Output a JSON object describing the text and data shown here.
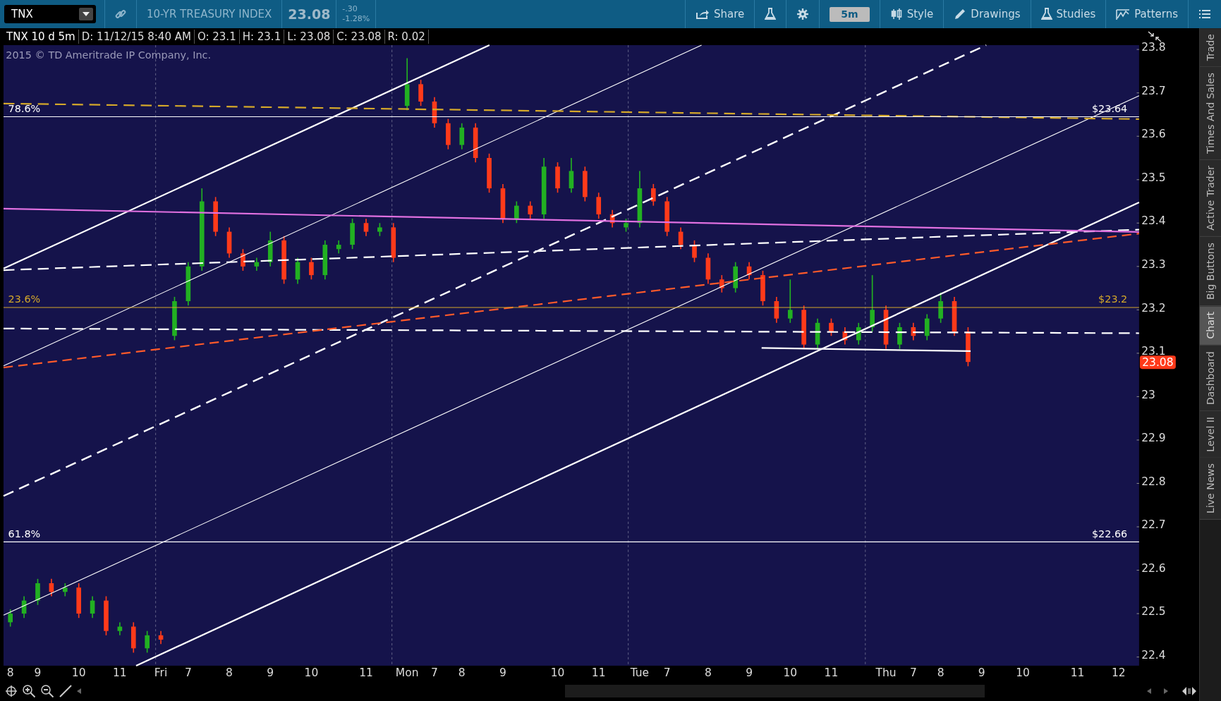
{
  "toolbar": {
    "symbol": "TNX",
    "description": "10-YR TREASURY INDEX",
    "last": "23.08",
    "change": "-.30",
    "change_pct": "-1.28%",
    "buttons": [
      {
        "kind": "share",
        "label": "Share"
      },
      {
        "kind": "flask"
      },
      {
        "kind": "gear"
      },
      {
        "kind": "aggregation",
        "label": "5m"
      },
      {
        "kind": "style",
        "label": "Style"
      },
      {
        "kind": "drawings",
        "label": "Drawings"
      },
      {
        "kind": "studies",
        "label": "Studies"
      },
      {
        "kind": "patterns",
        "label": "Patterns"
      },
      {
        "kind": "list"
      }
    ]
  },
  "info_bar": [
    "TNX 10 d 5m",
    "D: 11/12/15 8:40 AM",
    "O: 23.1",
    "H: 23.1",
    "L: 23.08",
    "C: 23.08",
    "R: 0.02"
  ],
  "chart": {
    "copyright": "2015 © TD Ameritrade IP Company, Inc.",
    "price_badge": "23.08",
    "fib_levels": [
      {
        "label": "78.6%",
        "price_label": "$23.64",
        "color": "#ffffff"
      },
      {
        "label": "23.6%",
        "price_label": "$23.2",
        "color": "#d4a82a"
      },
      {
        "label": "61.8%",
        "price_label": "$22.66",
        "color": "#ffffff"
      }
    ],
    "chart_data": {
      "type": "candlestick",
      "ylim": [
        22.38,
        23.81
      ],
      "categories": [
        "8",
        null,
        "9",
        null,
        null,
        "10",
        null,
        null,
        "11",
        null,
        null,
        "Fri",
        null,
        "7",
        null,
        null,
        "8",
        null,
        null,
        "9",
        null,
        null,
        "10",
        null,
        null,
        null,
        "11",
        null,
        null,
        "Mon",
        null,
        "7",
        null,
        "8",
        null,
        null,
        "9",
        null,
        null,
        null,
        "10",
        null,
        null,
        "11",
        null,
        null,
        "Tue",
        null,
        "7",
        null,
        null,
        "8",
        null,
        null,
        "9",
        null,
        null,
        "10",
        null,
        null,
        "11",
        null,
        null,
        null,
        "Thu",
        null,
        "7",
        null,
        "8",
        null,
        null,
        "9",
        null,
        null,
        "10",
        null,
        null,
        null,
        "11",
        null,
        null,
        "12",
        null
      ],
      "ohlc": [
        [
          22.48,
          22.51,
          22.47,
          22.5
        ],
        [
          22.5,
          22.54,
          22.49,
          22.53
        ],
        [
          22.53,
          22.58,
          22.52,
          22.57
        ],
        [
          22.57,
          22.58,
          22.54,
          22.55
        ],
        [
          22.55,
          22.57,
          22.54,
          22.56
        ],
        [
          22.56,
          22.57,
          22.49,
          22.5
        ],
        [
          22.5,
          22.54,
          22.49,
          22.53
        ],
        [
          22.53,
          22.54,
          22.45,
          22.46
        ],
        [
          22.46,
          22.48,
          22.45,
          22.47
        ],
        [
          22.47,
          22.48,
          22.41,
          22.42
        ],
        [
          22.42,
          22.46,
          22.41,
          22.45
        ],
        [
          22.45,
          22.46,
          22.43,
          22.44
        ],
        [
          23.14,
          23.23,
          23.13,
          23.22
        ],
        [
          23.22,
          23.31,
          23.21,
          23.3
        ],
        [
          23.3,
          23.48,
          23.29,
          23.45
        ],
        [
          23.45,
          23.46,
          23.37,
          23.38
        ],
        [
          23.38,
          23.39,
          23.32,
          23.33
        ],
        [
          23.33,
          23.34,
          23.29,
          23.3
        ],
        [
          23.3,
          23.32,
          23.29,
          23.31
        ],
        [
          23.31,
          23.38,
          23.3,
          23.36
        ],
        [
          23.36,
          23.37,
          23.26,
          23.27
        ],
        [
          23.27,
          23.32,
          23.26,
          23.31
        ],
        [
          23.31,
          23.32,
          23.27,
          23.28
        ],
        [
          23.28,
          23.36,
          23.27,
          23.35
        ],
        [
          23.34,
          23.36,
          23.33,
          23.35
        ],
        [
          23.35,
          23.41,
          23.34,
          23.4
        ],
        [
          23.4,
          23.41,
          23.37,
          23.38
        ],
        [
          23.38,
          23.4,
          23.37,
          23.39
        ],
        [
          23.39,
          23.4,
          23.31,
          23.32
        ],
        [
          23.67,
          23.78,
          23.66,
          23.72
        ],
        [
          23.72,
          23.73,
          23.67,
          23.68
        ],
        [
          23.68,
          23.69,
          23.62,
          23.63
        ],
        [
          23.63,
          23.64,
          23.57,
          23.58
        ],
        [
          23.58,
          23.63,
          23.57,
          23.62
        ],
        [
          23.62,
          23.63,
          23.54,
          23.55
        ],
        [
          23.55,
          23.56,
          23.47,
          23.48
        ],
        [
          23.48,
          23.49,
          23.4,
          23.41
        ],
        [
          23.41,
          23.45,
          23.4,
          23.44
        ],
        [
          23.44,
          23.45,
          23.41,
          23.42
        ],
        [
          23.42,
          23.55,
          23.41,
          23.53
        ],
        [
          23.53,
          23.54,
          23.47,
          23.48
        ],
        [
          23.48,
          23.55,
          23.47,
          23.52
        ],
        [
          23.52,
          23.53,
          23.45,
          23.46
        ],
        [
          23.46,
          23.47,
          23.41,
          23.42
        ],
        [
          23.42,
          23.43,
          23.39,
          23.4
        ],
        [
          23.39,
          23.41,
          23.38,
          23.4
        ],
        [
          23.4,
          23.52,
          23.39,
          23.48
        ],
        [
          23.48,
          23.49,
          23.44,
          23.45
        ],
        [
          23.45,
          23.46,
          23.37,
          23.38
        ],
        [
          23.38,
          23.39,
          23.34,
          23.35
        ],
        [
          23.35,
          23.36,
          23.31,
          23.32
        ],
        [
          23.32,
          23.33,
          23.26,
          23.27
        ],
        [
          23.27,
          23.28,
          23.24,
          23.25
        ],
        [
          23.25,
          23.31,
          23.24,
          23.3
        ],
        [
          23.3,
          23.31,
          23.27,
          23.28
        ],
        [
          23.28,
          23.29,
          23.21,
          23.22
        ],
        [
          23.22,
          23.23,
          23.17,
          23.18
        ],
        [
          23.18,
          23.27,
          23.17,
          23.2
        ],
        [
          23.2,
          23.21,
          23.11,
          23.12
        ],
        [
          23.12,
          23.18,
          23.11,
          23.17
        ],
        [
          23.17,
          23.18,
          23.14,
          23.15
        ],
        [
          23.15,
          23.16,
          23.12,
          23.13
        ],
        [
          23.13,
          23.17,
          23.12,
          23.16
        ],
        [
          23.16,
          23.28,
          23.15,
          23.2
        ],
        [
          23.2,
          23.21,
          23.11,
          23.12
        ],
        [
          23.12,
          23.17,
          23.11,
          23.16
        ],
        [
          23.16,
          23.17,
          23.13,
          23.14
        ],
        [
          23.14,
          23.19,
          23.13,
          23.18
        ],
        [
          23.18,
          23.24,
          23.17,
          23.22
        ],
        [
          23.22,
          23.23,
          23.14,
          23.15
        ],
        [
          23.15,
          23.16,
          23.07,
          23.08
        ],
        null,
        null,
        null,
        null,
        null,
        null,
        null,
        null,
        null,
        null,
        null,
        null
      ],
      "yticks": [
        22.4,
        22.5,
        22.6,
        22.7,
        22.8,
        22.9,
        23,
        23.1,
        23.2,
        23.3,
        23.4,
        23.5,
        23.6,
        23.7,
        23.8
      ]
    }
  },
  "side_tabs": [
    {
      "label": "Trade",
      "selected": false
    },
    {
      "label": "Times And Sales",
      "selected": false
    },
    {
      "label": "Active Trader",
      "selected": false
    },
    {
      "label": "Big Buttons",
      "selected": false
    },
    {
      "label": "Chart",
      "selected": true
    },
    {
      "label": "Dashboard",
      "selected": false
    },
    {
      "label": "Level II",
      "selected": false
    },
    {
      "label": "Live News",
      "selected": false
    }
  ]
}
